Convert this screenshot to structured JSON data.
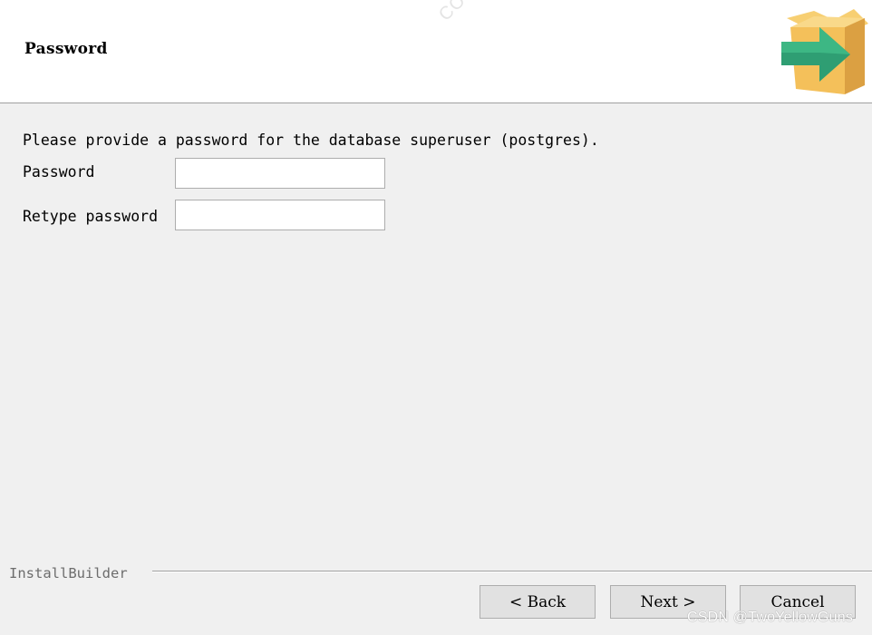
{
  "header": {
    "title": "Password",
    "watermark": "COCA",
    "logo_icon": "package-arrow-icon",
    "colors": {
      "box": "#f4c05a",
      "box_shade": "#dba042",
      "arrow": "#3aa87a"
    }
  },
  "content": {
    "prompt": "Please provide a password for the database superuser (postgres).",
    "fields": [
      {
        "label": "Password",
        "value": "",
        "placeholder": ""
      },
      {
        "label": "Retype password",
        "value": "",
        "placeholder": ""
      }
    ]
  },
  "footer": {
    "brand": "InstallBuilder",
    "buttons": {
      "back": "< Back",
      "next": "Next >",
      "cancel": "Cancel"
    },
    "credit": "CSDN @TwoYellowGuns"
  }
}
